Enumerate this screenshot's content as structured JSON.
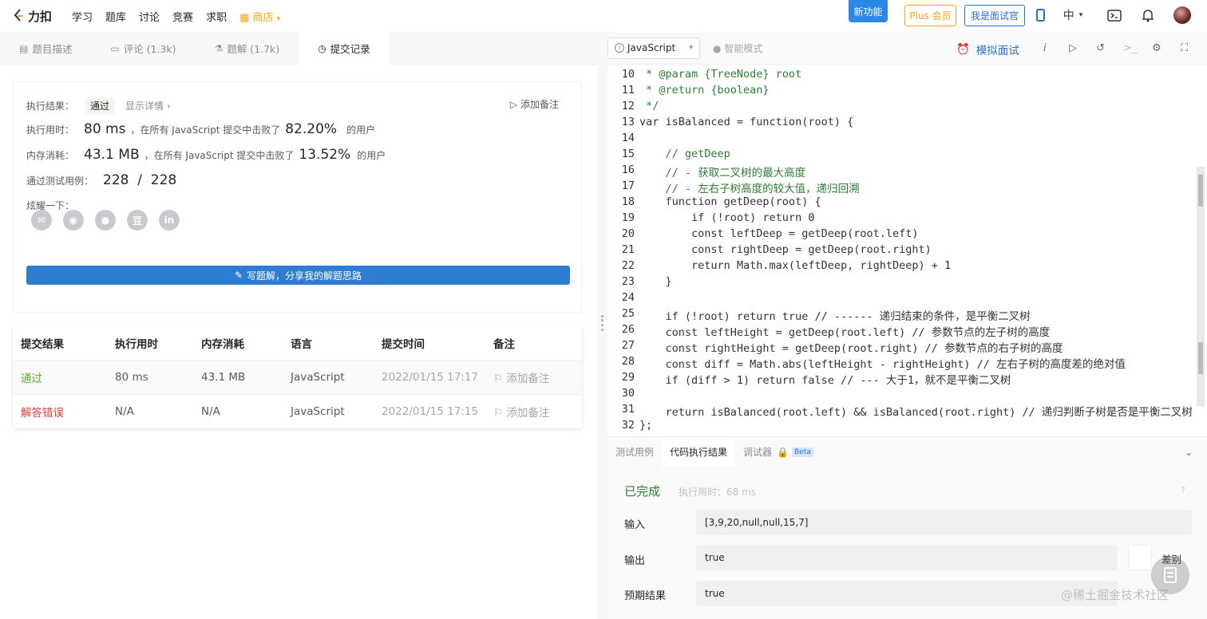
{
  "topnav": {
    "logo_text": "力扣",
    "items": [
      "学习",
      "题库",
      "讨论",
      "竞赛",
      "求职"
    ],
    "store_label": "商店",
    "new_feature": "新功能",
    "plus_label": "Plus 会员",
    "interviewer_label": "我是面试官",
    "lang_label": "中"
  },
  "left_tabs": [
    {
      "label": "题目描述",
      "icon": "document-icon"
    },
    {
      "label": "评论 (1.3k)",
      "icon": "comment-icon"
    },
    {
      "label": "题解 (1.7k)",
      "icon": "flask-icon"
    },
    {
      "label": "提交记录",
      "icon": "clock-icon"
    }
  ],
  "result": {
    "status_label": "执行结果：",
    "status_value": "通过",
    "show_detail": "显示详情 ›",
    "add_note": "添加备注",
    "time_label": "执行用时：",
    "time_value": "80 ms",
    "time_desc": "，在所有 JavaScript 提交中击败了",
    "time_pct": "82.20%",
    "time_suffix": "的用户",
    "mem_label": "内存消耗：",
    "mem_value": "43.1 MB",
    "mem_desc": "，在所有 JavaScript 提交中击败了",
    "mem_pct": "13.52%",
    "mem_suffix": "的用户",
    "tests_label": "通过测试用例：",
    "tests_value": "228  /  228",
    "share_label": "炫耀一下：",
    "share_icons": [
      "wechat-icon",
      "weibo-icon",
      "qq-icon",
      "douban-icon",
      "linkedin-icon"
    ],
    "write_btn": "写题解，分享我的解题思路"
  },
  "submissions": {
    "headers": [
      "提交结果",
      "执行用时",
      "内存消耗",
      "语言",
      "提交时间",
      "备注"
    ],
    "rows": [
      {
        "result": "通过",
        "time": "80 ms",
        "mem": "43.1 MB",
        "lang": "JavaScript",
        "date": "2022/01/15 17:17",
        "note": "添加备注"
      },
      {
        "result": "解答错误",
        "time": "N/A",
        "mem": "N/A",
        "lang": "JavaScript",
        "date": "2022/01/15 17:15",
        "note": "添加备注"
      }
    ]
  },
  "toolbar": {
    "language": "JavaScript",
    "smart_mode": "智能模式",
    "mock_interview": "模拟面试"
  },
  "code_lines": [
    {
      "n": "10",
      "t": " * @param {TreeNode} root"
    },
    {
      "n": "11",
      "t": " * @return {boolean}"
    },
    {
      "n": "12",
      "t": " */"
    },
    {
      "n": "13",
      "t": "var isBalanced = function(root) {"
    },
    {
      "n": "14",
      "t": ""
    },
    {
      "n": "15",
      "t": "    // getDeep"
    },
    {
      "n": "16",
      "t": "    // - 获取二叉树的最大高度"
    },
    {
      "n": "17",
      "t": "    // - 左右子树高度的较大值，递归回溯"
    },
    {
      "n": "18",
      "t": "    function getDeep(root) {"
    },
    {
      "n": "19",
      "t": "        if (!root) return 0"
    },
    {
      "n": "20",
      "t": "        const leftDeep = getDeep(root.left)"
    },
    {
      "n": "21",
      "t": "        const rightDeep = getDeep(root.right)"
    },
    {
      "n": "22",
      "t": "        return Math.max(leftDeep, rightDeep) + 1"
    },
    {
      "n": "23",
      "t": "    }"
    },
    {
      "n": "24",
      "t": ""
    },
    {
      "n": "25",
      "t": "    if (!root) return true // ------ 递归结束的条件，是平衡二叉树"
    },
    {
      "n": "26",
      "t": "    const leftHeight = getDeep(root.left) // 参数节点的左子树的高度"
    },
    {
      "n": "27",
      "t": "    const rightHeight = getDeep(root.right) // 参数节点的右子树的高度"
    },
    {
      "n": "28",
      "t": "    const diff = Math.abs(leftHeight - rightHeight) // 左右子树的高度差的绝对值"
    },
    {
      "n": "29",
      "t": "    if (diff > 1) return false // --- 大于1，就不是平衡二叉树"
    },
    {
      "n": "30",
      "t": ""
    },
    {
      "n": "31",
      "t": "    return isBalanced(root.left) && isBalanced(root.right) // 递归判断子树是否是平衡二叉树"
    },
    {
      "n": "32",
      "t": "};"
    }
  ],
  "bottom_tabs": [
    "测试用例",
    "代码执行结果",
    "调试器"
  ],
  "beta": "Beta",
  "run": {
    "done": "已完成",
    "exec_time": "执行用时：68 ms",
    "input_label": "输入",
    "input_value": "[3,9,20,null,null,15,7]",
    "output_label": "输出",
    "output_value": "true",
    "diff_label": "差别",
    "expected_label": "预期结果",
    "expected_value": "true"
  },
  "watermark": "@稀土掘金技术社区"
}
